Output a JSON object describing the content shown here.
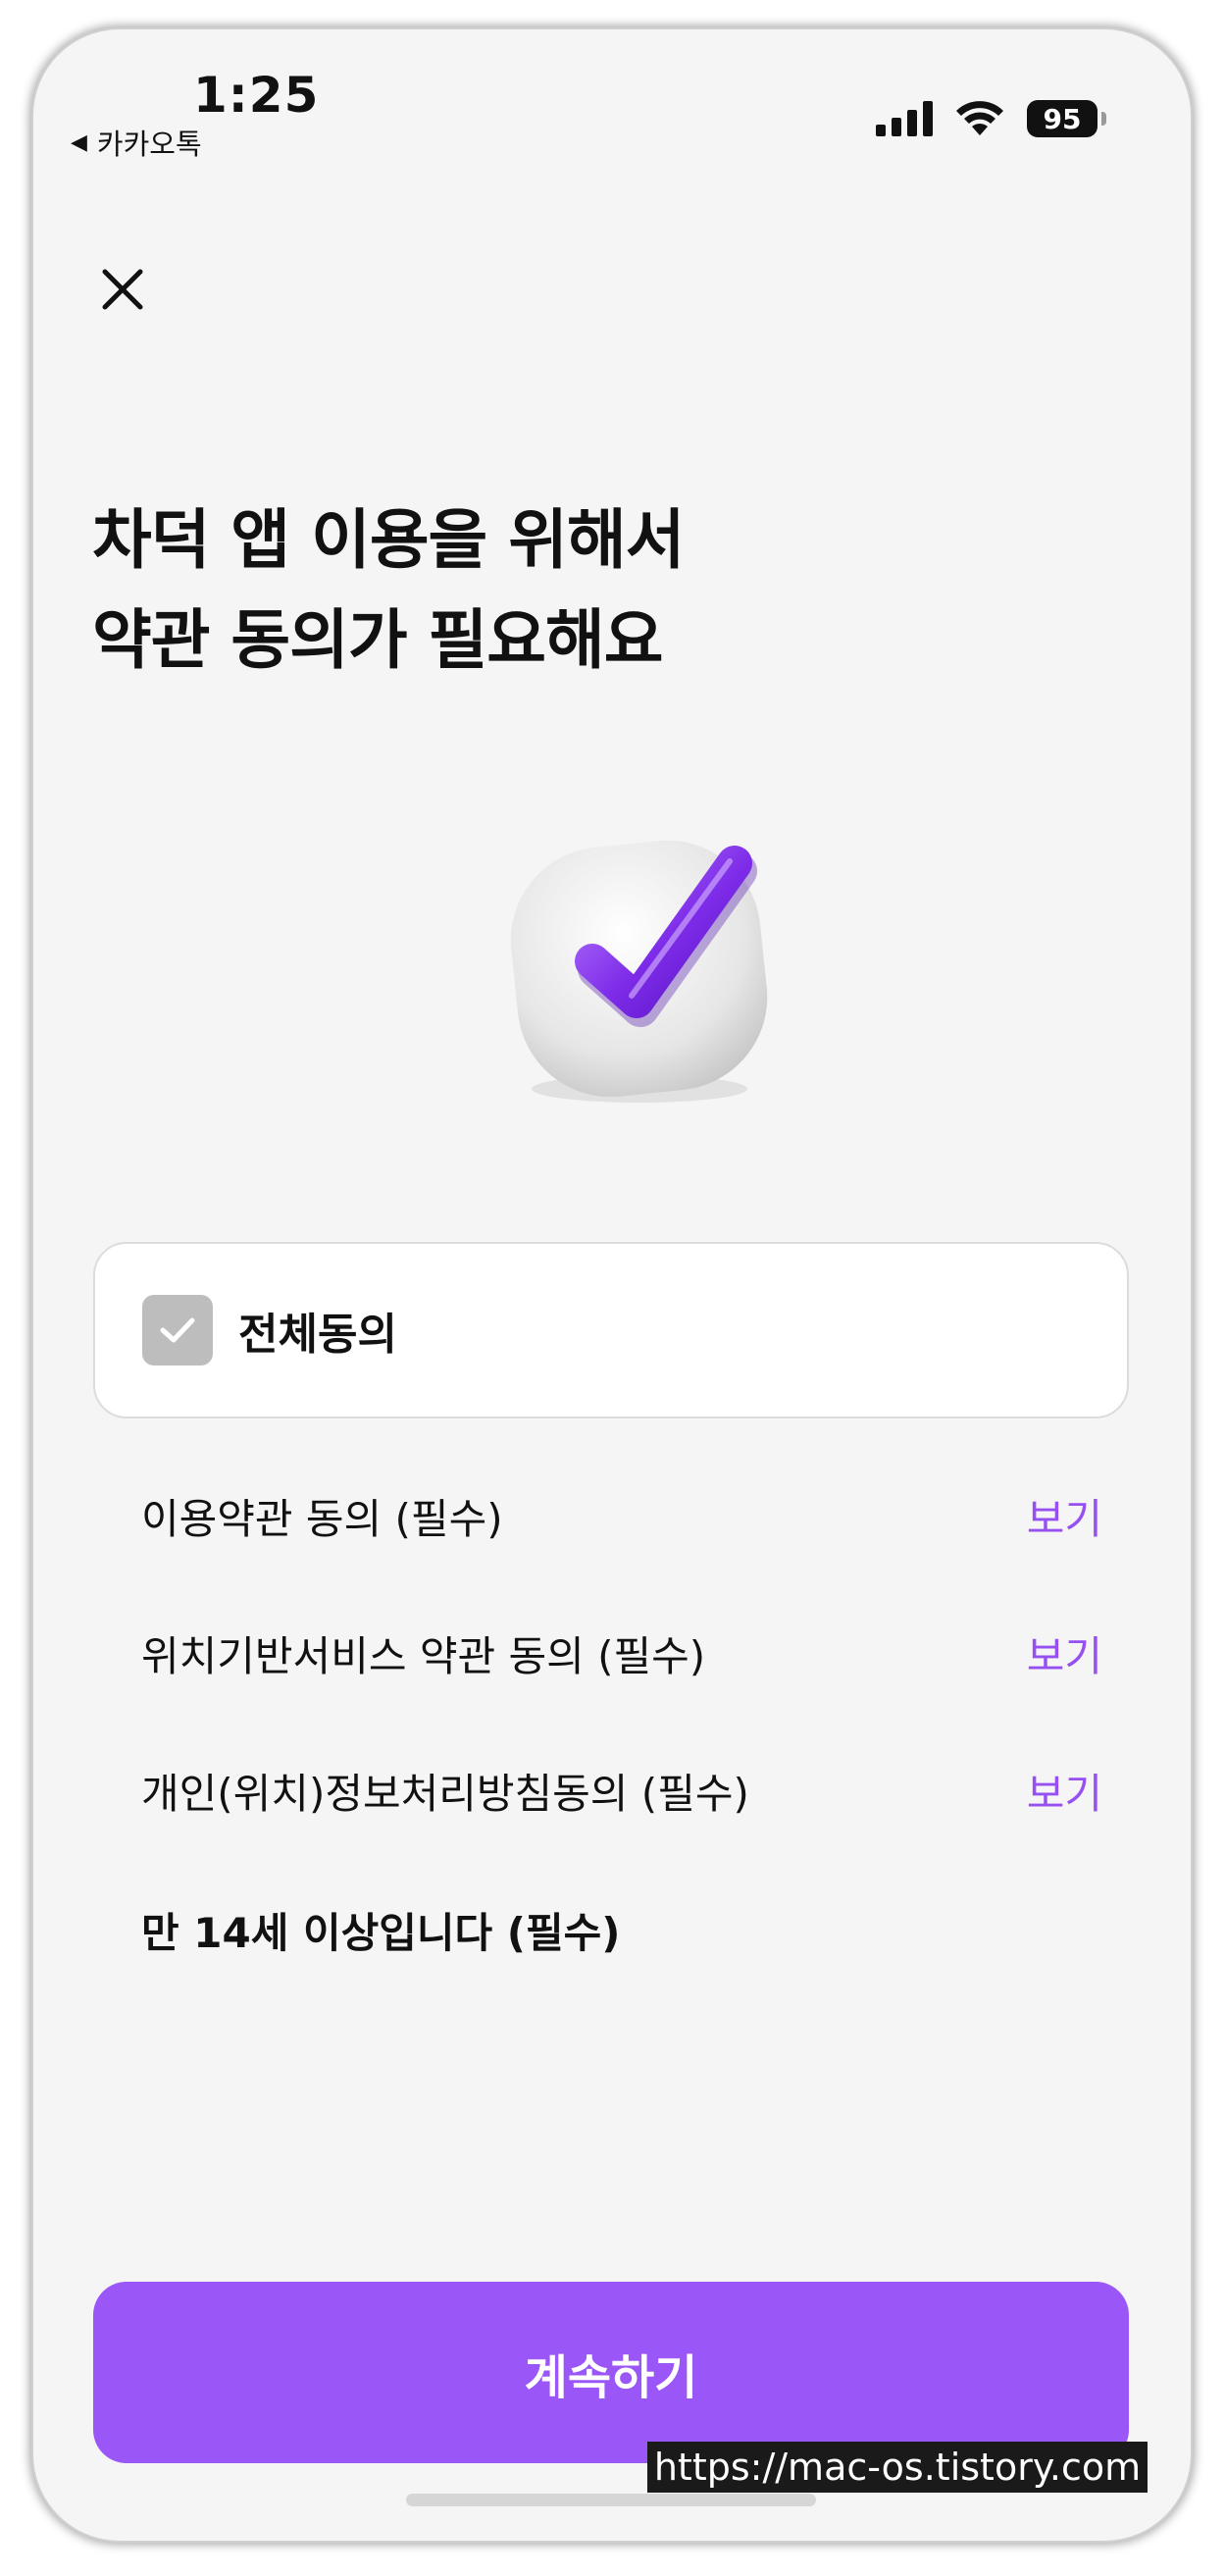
{
  "status_bar": {
    "time": "1:25",
    "back_app": "카카오톡",
    "battery": "95"
  },
  "header": {
    "close_icon": "close-icon"
  },
  "title": {
    "line1": "차덕 앱 이용을 위해서",
    "line2": "약관 동의가 필요해요"
  },
  "hero_icon": "checkbox-check-3d-icon",
  "agree_all": {
    "label": "전체동의",
    "checked": false
  },
  "terms": [
    {
      "label": "이용약관 동의 (필수)",
      "view": "보기"
    },
    {
      "label": "위치기반서비스 약관 동의 (필수)",
      "view": "보기"
    },
    {
      "label": "개인(위치)정보처리방침동의 (필수)",
      "view": "보기"
    },
    {
      "label": "만 14세 이상입니다 (필수)"
    }
  ],
  "continue_button": "계속하기",
  "watermark": "https://mac-os.tistory.com",
  "colors": {
    "accent": "#9B56F7",
    "link": "#9650F0",
    "background": "#F5F5F5"
  }
}
